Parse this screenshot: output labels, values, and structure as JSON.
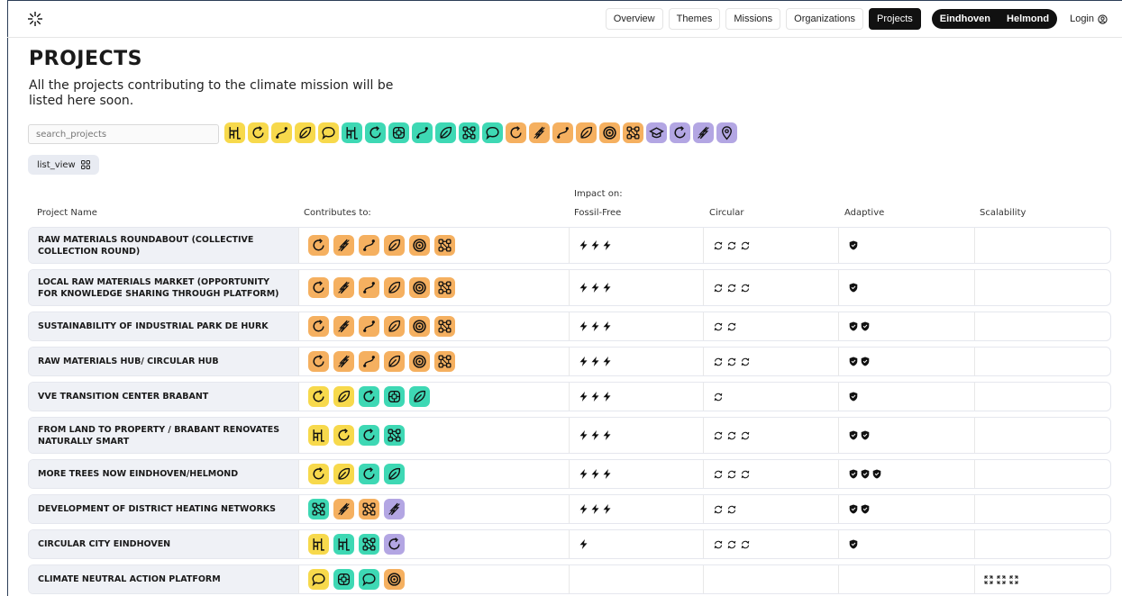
{
  "nav": {
    "items": [
      "Overview",
      "Themes",
      "Missions",
      "Organizations",
      "Projects"
    ],
    "active_index": 4,
    "cities": [
      "Eindhoven",
      "Helmond"
    ],
    "login_label": "Login"
  },
  "page": {
    "title": "PROJECTS",
    "intro": "All the projects contributing to the climate mission will be listed here soon.",
    "search_placeholder": "search_projects",
    "list_view_label": "list_view"
  },
  "colors": {
    "orange": "#f5b060",
    "yellow": "#f7d94c",
    "teal": "#3ed8b4",
    "purple": "#b3a6e3"
  },
  "filters": [
    {
      "color": "yellow",
      "icon": "stairs-icon"
    },
    {
      "color": "yellow",
      "icon": "cycle-icon"
    },
    {
      "color": "yellow",
      "icon": "route-icon"
    },
    {
      "color": "yellow",
      "icon": "leaf-icon"
    },
    {
      "color": "yellow",
      "icon": "chat-icon"
    },
    {
      "color": "teal",
      "icon": "stairs-icon"
    },
    {
      "color": "teal",
      "icon": "cycle-icon"
    },
    {
      "color": "teal",
      "icon": "grid-icon"
    },
    {
      "color": "teal",
      "icon": "route-icon"
    },
    {
      "color": "teal",
      "icon": "leaf-icon"
    },
    {
      "color": "teal",
      "icon": "network-icon"
    },
    {
      "color": "teal",
      "icon": "chat-icon"
    },
    {
      "color": "orange",
      "icon": "cycle-icon"
    },
    {
      "color": "orange",
      "icon": "bolt-icon"
    },
    {
      "color": "orange",
      "icon": "route-icon"
    },
    {
      "color": "orange",
      "icon": "leaf-icon"
    },
    {
      "color": "orange",
      "icon": "target-icon"
    },
    {
      "color": "orange",
      "icon": "network-icon"
    },
    {
      "color": "purple",
      "icon": "graduation-cap-icon"
    },
    {
      "color": "purple",
      "icon": "cycle-icon"
    },
    {
      "color": "purple",
      "icon": "bolt-icon"
    },
    {
      "color": "purple",
      "icon": "location-pin-icon"
    }
  ],
  "table": {
    "impact_label": "Impact on:",
    "headers": {
      "name": "Project Name",
      "contributes": "Contributes to:",
      "fossil_free": "Fossil-Free",
      "circular": "Circular",
      "adaptive": "Adaptive",
      "scalability": "Scalability"
    },
    "rows": [
      {
        "name": "RAW MATERIALS ROUNDABOUT (COLLECTIVE COLLECTION ROUND)",
        "tall": true,
        "contributes": [
          [
            "orange",
            "cycle-icon"
          ],
          [
            "orange",
            "bolt-icon"
          ],
          [
            "orange",
            "route-icon"
          ],
          [
            "orange",
            "leaf-icon"
          ],
          [
            "orange",
            "target-icon"
          ],
          [
            "orange",
            "network-icon"
          ]
        ],
        "fossil_free": 3,
        "circular": 3,
        "adaptive": 1,
        "scalability": 0
      },
      {
        "name": "LOCAL RAW MATERIALS MARKET (OPPORTUNITY FOR KNOWLEDGE SHARING THROUGH PLATFORM)",
        "tall": true,
        "contributes": [
          [
            "orange",
            "cycle-icon"
          ],
          [
            "orange",
            "bolt-icon"
          ],
          [
            "orange",
            "route-icon"
          ],
          [
            "orange",
            "leaf-icon"
          ],
          [
            "orange",
            "target-icon"
          ],
          [
            "orange",
            "network-icon"
          ]
        ],
        "fossil_free": 3,
        "circular": 3,
        "adaptive": 1,
        "scalability": 0
      },
      {
        "name": "SUSTAINABILITY OF INDUSTRIAL PARK DE HURK",
        "tall": false,
        "contributes": [
          [
            "orange",
            "cycle-icon"
          ],
          [
            "orange",
            "bolt-icon"
          ],
          [
            "orange",
            "route-icon"
          ],
          [
            "orange",
            "leaf-icon"
          ],
          [
            "orange",
            "target-icon"
          ],
          [
            "orange",
            "network-icon"
          ]
        ],
        "fossil_free": 3,
        "circular": 2,
        "adaptive": 2,
        "scalability": 0
      },
      {
        "name": "RAW MATERIALS HUB/ CIRCULAR HUB",
        "tall": false,
        "contributes": [
          [
            "orange",
            "cycle-icon"
          ],
          [
            "orange",
            "bolt-icon"
          ],
          [
            "orange",
            "route-icon"
          ],
          [
            "orange",
            "leaf-icon"
          ],
          [
            "orange",
            "target-icon"
          ],
          [
            "orange",
            "network-icon"
          ]
        ],
        "fossil_free": 3,
        "circular": 3,
        "adaptive": 2,
        "scalability": 0
      },
      {
        "name": "VVE TRANSITION CENTER BRABANT",
        "tall": false,
        "contributes": [
          [
            "yellow",
            "cycle-icon"
          ],
          [
            "yellow",
            "leaf-icon"
          ],
          [
            "teal",
            "cycle-icon"
          ],
          [
            "teal",
            "grid-icon"
          ],
          [
            "teal",
            "leaf-icon"
          ]
        ],
        "fossil_free": 3,
        "circular": 1,
        "adaptive": 1,
        "scalability": 0
      },
      {
        "name": "FROM LAND TO PROPERTY / BRABANT RENOVATES NATURALLY SMART",
        "tall": true,
        "contributes": [
          [
            "yellow",
            "stairs-icon"
          ],
          [
            "yellow",
            "cycle-icon"
          ],
          [
            "teal",
            "cycle-icon"
          ],
          [
            "teal",
            "network-icon"
          ]
        ],
        "fossil_free": 3,
        "circular": 3,
        "adaptive": 2,
        "scalability": 0
      },
      {
        "name": "MORE TREES NOW EINDHOVEN/HELMOND",
        "tall": false,
        "contributes": [
          [
            "yellow",
            "cycle-icon"
          ],
          [
            "yellow",
            "leaf-icon"
          ],
          [
            "teal",
            "cycle-icon"
          ],
          [
            "teal",
            "leaf-icon"
          ]
        ],
        "fossil_free": 3,
        "circular": 3,
        "adaptive": 3,
        "scalability": 0
      },
      {
        "name": "DEVELOPMENT OF DISTRICT HEATING NETWORKS",
        "tall": false,
        "contributes": [
          [
            "teal",
            "network-icon"
          ],
          [
            "orange",
            "bolt-icon"
          ],
          [
            "orange",
            "network-icon"
          ],
          [
            "purple",
            "bolt-icon"
          ]
        ],
        "fossil_free": 3,
        "circular": 2,
        "adaptive": 2,
        "scalability": 0
      },
      {
        "name": "CIRCULAR CITY EINDHOVEN",
        "tall": false,
        "contributes": [
          [
            "yellow",
            "stairs-icon"
          ],
          [
            "teal",
            "stairs-icon"
          ],
          [
            "teal",
            "network-icon"
          ],
          [
            "purple",
            "cycle-icon"
          ]
        ],
        "fossil_free": 1,
        "circular": 3,
        "adaptive": 1,
        "scalability": 0
      },
      {
        "name": "CLIMATE NEUTRAL ACTION PLATFORM",
        "tall": false,
        "contributes": [
          [
            "yellow",
            "chat-icon"
          ],
          [
            "teal",
            "grid-icon"
          ],
          [
            "teal",
            "chat-icon"
          ],
          [
            "orange",
            "target-icon"
          ]
        ],
        "fossil_free": 0,
        "circular": 0,
        "adaptive": 0,
        "scalability": 3
      }
    ]
  }
}
